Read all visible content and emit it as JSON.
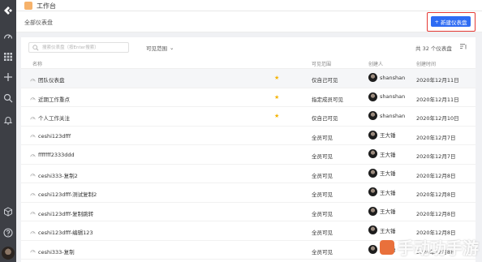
{
  "app": {
    "title": "工作台"
  },
  "breadcrumb": "全部仪表盘",
  "toolbar": {
    "new_button_label": "新建仪表盘",
    "new_button_plus": "+"
  },
  "search": {
    "placeholder": "搜索仪表盘（按Enter搜索）"
  },
  "scope_filter": {
    "label": "可见范围",
    "chevron": "⌄"
  },
  "total_count": "共 32 个仪表盘",
  "table": {
    "headers": {
      "name": "名称",
      "visibility": "可见范围",
      "creator": "创建人",
      "created": "创建时间"
    },
    "rows": [
      {
        "name": "团队仪表盘",
        "starred": true,
        "star": "★",
        "visibility": "仅自己可见",
        "creator": "shanshan",
        "date": "2020年12月11日"
      },
      {
        "name": "近期工作重点",
        "starred": true,
        "star": "★",
        "visibility": "指定成员可见",
        "creator": "shanshan",
        "date": "2020年12月11日"
      },
      {
        "name": "个人工作关注",
        "starred": true,
        "star": "★",
        "visibility": "仅自己可见",
        "creator": "shanshan",
        "date": "2020年12月10日"
      },
      {
        "name": "ceshi123dfff",
        "starred": false,
        "star": "",
        "visibility": "全员可见",
        "creator": "王大锤",
        "date": "2020年12月7日"
      },
      {
        "name": "fffffff2333ddd",
        "starred": false,
        "star": "",
        "visibility": "全员可见",
        "creator": "王大锤",
        "date": "2020年12月7日"
      },
      {
        "name": "ceshi333-复制2",
        "starred": false,
        "star": "",
        "visibility": "全员可见",
        "creator": "王大锤",
        "date": "2020年12月8日"
      },
      {
        "name": "ceshi123dfff-测试复制2",
        "starred": false,
        "star": "",
        "visibility": "全员可见",
        "creator": "王大锤",
        "date": "2020年12月8日"
      },
      {
        "name": "ceshi123dfff-复制跳转",
        "starred": false,
        "star": "",
        "visibility": "全员可见",
        "creator": "王大锤",
        "date": "2020年12月8日"
      },
      {
        "name": "ceshi123dfff-编辑123",
        "starred": false,
        "star": "",
        "visibility": "全员可见",
        "creator": "王大锤",
        "date": "2020年12月8日"
      },
      {
        "name": "ceshi333-复制",
        "starred": false,
        "star": "",
        "visibility": "全员可见",
        "creator": "王大锤",
        "date": "2020年12月8日"
      }
    ]
  },
  "watermark": "手动功手游",
  "colors": {
    "primary": "#2d6bf3",
    "highlight_border": "#e53935",
    "star": "#f5b300",
    "rail": "#3d3f45"
  }
}
